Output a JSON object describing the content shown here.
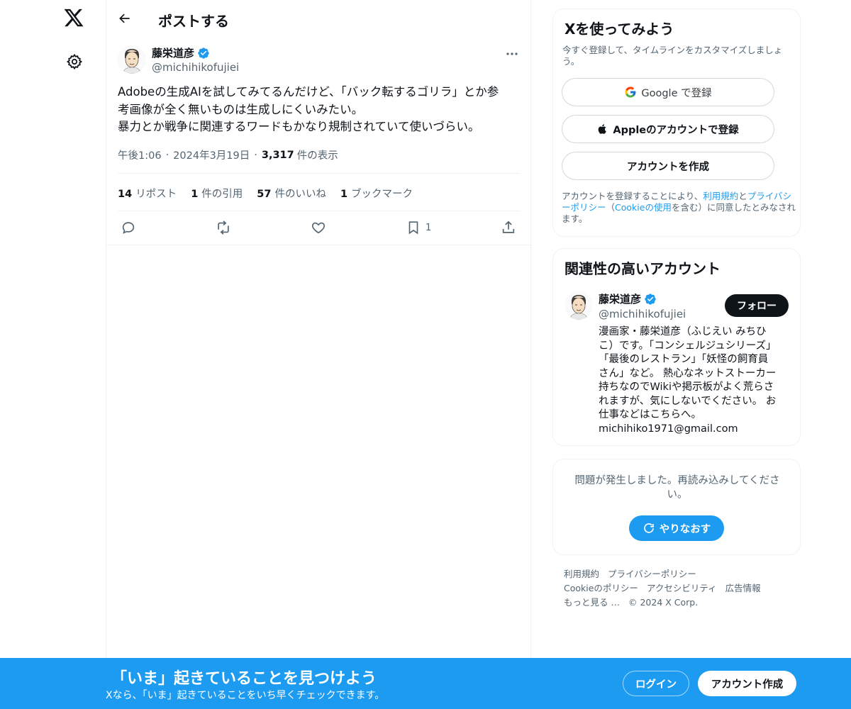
{
  "nav": {
    "logo_icon": "x-logo-icon",
    "settings_icon": "gear-icon"
  },
  "header": {
    "title": "ポストする",
    "back_icon": "arrow-left-icon"
  },
  "tweet": {
    "author_name": "藤栄道彦",
    "author_handle": "@michihikofujiei",
    "verified": true,
    "text_lines": [
      "Adobeの生成AIを試してみてるんだけど、「バック転するゴリラ」とか参",
      "考画像が全く無いものは生成しにくいみたい。",
      "暴力とか戦争に関連するワードもかなり規制されていて使いづらい。"
    ],
    "time": "午後1:06",
    "date": "2024年3月19日",
    "views_count": "3,317",
    "views_label": "件の表示",
    "stats": {
      "reposts_count": "14",
      "reposts_label": "リポスト",
      "quotes_count": "1",
      "quotes_label": "件の引用",
      "likes_count": "57",
      "likes_label": "件のいいね",
      "bookmarks_count": "1",
      "bookmarks_label": "ブックマーク"
    },
    "actions": {
      "bookmark_count": "1"
    }
  },
  "signup": {
    "title": "Xを使ってみよう",
    "subtitle": "今すぐ登録して、タイムラインをカスタマイズしましょう。",
    "google_label": "Google で登録",
    "apple_label": "Appleのアカウントで登録",
    "create_label": "アカウントを作成",
    "legal_prefix": "アカウントを登録することにより、",
    "legal_terms": "利用規約",
    "legal_and": "と",
    "legal_privacy": "プライバシーポリシー",
    "legal_paren_open": "（",
    "legal_cookie": "Cookieの使用",
    "legal_suffix": "を含む）に同意したとみなされます。"
  },
  "related": {
    "title": "関連性の高いアカウント",
    "name": "藤栄道彦",
    "handle": "@michihikofujiei",
    "follow_label": "フォロー",
    "bio_lines": [
      "漫画家・藤栄道彦（ふじえい みちひ",
      "こ）です。「コンシェルジュシリーズ」",
      "「最後のレストラン」「妖怪の飼育員",
      "さん」など。 熱心なネットストーカー",
      "持ちなのでWikiや掲示板がよく荒らさ",
      "れますが、気にしないでください。 お",
      "仕事などはこちらへ。",
      "michihiko1971@gmail.com"
    ]
  },
  "error": {
    "message": "問題が発生しました。再読み込みしてください。",
    "retry_label": "やりなおす"
  },
  "footer": {
    "terms": "利用規約",
    "privacy": "プライバシーポリシー",
    "cookie": "Cookieのポリシー",
    "accessibility": "アクセシビリティ",
    "ads": "広告情報",
    "more": "もっと見る …",
    "copyright": "© 2024 X Corp."
  },
  "bottom_bar": {
    "title": "「いま」起きていることを見つけよう",
    "subtitle": "Xなら、「いま」起きていることをいち早くチェックできます。",
    "login_label": "ログイン",
    "create_label": "アカウント作成"
  },
  "colors": {
    "accent": "#1d9bf0",
    "text": "#0f1419",
    "muted": "#536471",
    "border": "#eff3f4"
  }
}
